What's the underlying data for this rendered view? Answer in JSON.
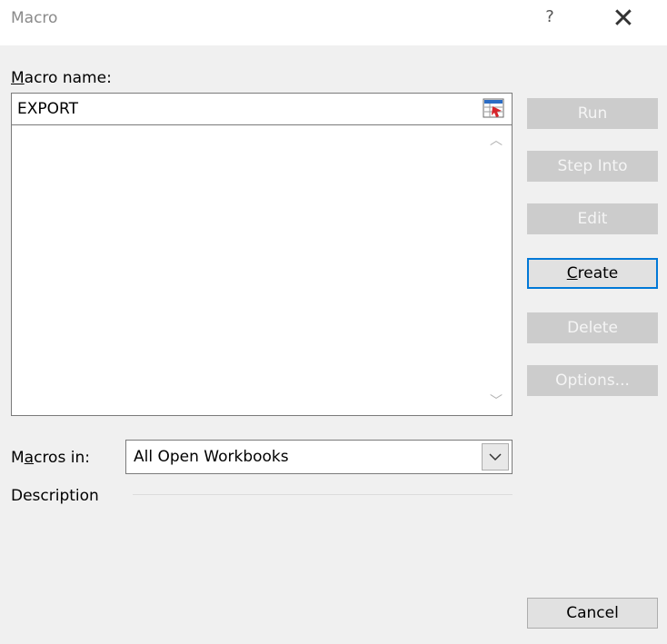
{
  "dialog": {
    "title": "Macro",
    "help_label": "?",
    "close_label": "✕"
  },
  "macro_name": {
    "label_accel": "M",
    "label_rest": "acro name:",
    "value": "EXPORT"
  },
  "macros_in": {
    "label_pre": "M",
    "label_accel": "a",
    "label_rest": "cros in:",
    "selected": "All Open Workbooks"
  },
  "description": {
    "label": "Description"
  },
  "buttons": {
    "run": "Run",
    "step_into": "Step Into",
    "edit": "Edit",
    "create_accel": "C",
    "create_rest": "reate",
    "delete": "Delete",
    "options": "Options...",
    "cancel": "Cancel"
  },
  "colors": {
    "accent": "#0078d7",
    "disabled_button": "#cccccc",
    "dialog_body": "#f0f0f0"
  }
}
